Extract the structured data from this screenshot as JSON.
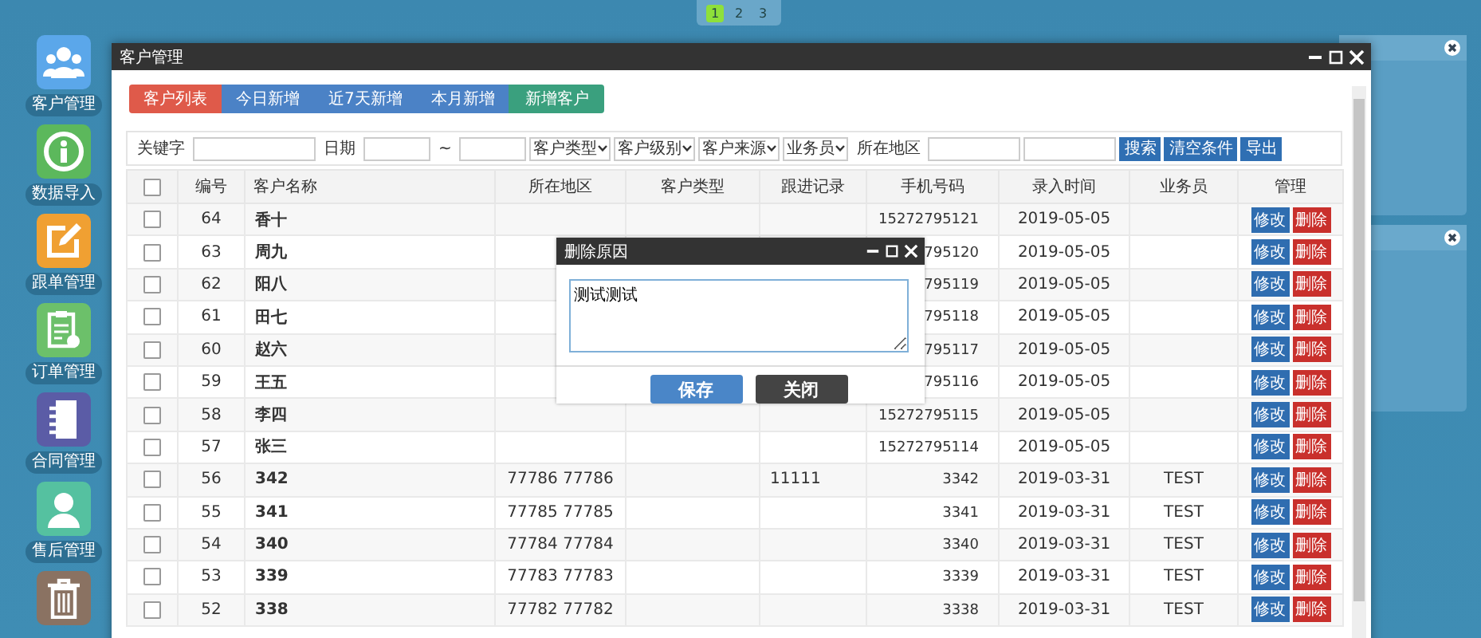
{
  "pager": [
    {
      "label": "1",
      "selected": true
    },
    {
      "label": "2",
      "selected": false
    },
    {
      "label": "3",
      "selected": false
    }
  ],
  "dock": [
    {
      "label": "客户管理",
      "color": "#5ba7ea"
    },
    {
      "label": "数据导入",
      "color": "#5cb85c"
    },
    {
      "label": "跟单管理",
      "color": "#f0a032"
    },
    {
      "label": "订单管理",
      "color": "#6cc06a"
    },
    {
      "label": "合同管理",
      "color": "#5b5ca6"
    },
    {
      "label": "售后管理",
      "color": "#55c1a0"
    },
    {
      "color": "#8a7262"
    }
  ],
  "window": {
    "title": "客户管理"
  },
  "tabs": [
    {
      "label": "客户列表",
      "selected": true
    },
    {
      "label": "今日新增",
      "selected": false
    },
    {
      "label": "近7天新增",
      "selected": false
    },
    {
      "label": "本月新增",
      "selected": false
    }
  ],
  "add_button": "新增客户",
  "filters": [
    {
      "kind": "label",
      "text": "关键字"
    },
    {
      "kind": "input"
    },
    {
      "kind": "label",
      "text": "日期"
    },
    {
      "kind": "input"
    },
    {
      "kind": "label",
      "text": "~"
    },
    {
      "kind": "input"
    },
    {
      "kind": "select",
      "text": "客户类型"
    },
    {
      "kind": "select",
      "text": "客户级别"
    },
    {
      "kind": "select",
      "text": "客户来源"
    },
    {
      "kind": "select",
      "text": "业务员"
    },
    {
      "kind": "label",
      "text": "所在地区"
    },
    {
      "kind": "input"
    },
    {
      "kind": "input"
    },
    {
      "kind": "button",
      "text": "搜索"
    },
    {
      "kind": "button",
      "text": "清空条件"
    },
    {
      "kind": "button",
      "text": "导出"
    }
  ],
  "table": {
    "header_checked": false,
    "columns": [
      "编号",
      "客户名称",
      "所在地区",
      "客户类型",
      "跟进记录",
      "手机号码",
      "录入时间",
      "业务员",
      "管理"
    ],
    "rows": [
      {
        "checked": false,
        "id": "64",
        "name": "香十",
        "phone": "15272795121",
        "date": "2019-05-05",
        "actions": [
          "修改",
          "删除"
        ]
      },
      {
        "checked": false,
        "id": "63",
        "name": "周九",
        "phone": "795120",
        "date": "2019-05-05",
        "actions": [
          "修改",
          "删除"
        ]
      },
      {
        "checked": false,
        "id": "62",
        "name": "阳八",
        "phone": "795119",
        "date": "2019-05-05",
        "actions": [
          "修改",
          "删除"
        ]
      },
      {
        "checked": false,
        "id": "61",
        "name": "田七",
        "phone": "795118",
        "date": "2019-05-05",
        "actions": [
          "修改",
          "删除"
        ]
      },
      {
        "checked": false,
        "id": "60",
        "name": "赵六",
        "phone": "795117",
        "date": "2019-05-05",
        "actions": [
          "修改",
          "删除"
        ]
      },
      {
        "checked": false,
        "id": "59",
        "name": "王五",
        "phone": "795116",
        "date": "2019-05-05",
        "actions": [
          "修改",
          "删除"
        ]
      },
      {
        "checked": false,
        "id": "58",
        "name": "李四",
        "phone": "15272795115",
        "date": "2019-05-05",
        "actions": [
          "修改",
          "删除"
        ]
      },
      {
        "checked": false,
        "id": "57",
        "name": "张三",
        "phone": "15272795114",
        "date": "2019-05-05",
        "actions": [
          "修改",
          "删除"
        ]
      },
      {
        "checked": false,
        "id": "56",
        "name": "342",
        "region": "77786 77786",
        "follow": "11111",
        "phone": "3342",
        "date": "2019-03-31",
        "staff": "TEST",
        "actions": [
          "修改",
          "删除"
        ]
      },
      {
        "checked": false,
        "id": "55",
        "name": "341",
        "region": "77785 77785",
        "phone": "3341",
        "date": "2019-03-31",
        "staff": "TEST",
        "actions": [
          "修改",
          "删除"
        ]
      },
      {
        "checked": false,
        "id": "54",
        "name": "340",
        "region": "77784 77784",
        "phone": "3340",
        "date": "2019-03-31",
        "staff": "TEST",
        "actions": [
          "修改",
          "删除"
        ]
      },
      {
        "checked": false,
        "id": "53",
        "name": "339",
        "region": "77783 77783",
        "phone": "3339",
        "date": "2019-03-31",
        "staff": "TEST",
        "actions": [
          "修改",
          "删除"
        ]
      },
      {
        "checked": false,
        "id": "52",
        "name": "338",
        "region": "77782 77782",
        "phone": "3338",
        "date": "2019-03-31",
        "staff": "TEST",
        "actions": [
          "修改",
          "删除"
        ]
      }
    ]
  },
  "dialog": {
    "title": "删除原因",
    "text": "测试测试",
    "buttons": [
      {
        "label": "保存",
        "kind": "primary"
      },
      {
        "label": "关闭",
        "kind": "secondary"
      }
    ]
  }
}
